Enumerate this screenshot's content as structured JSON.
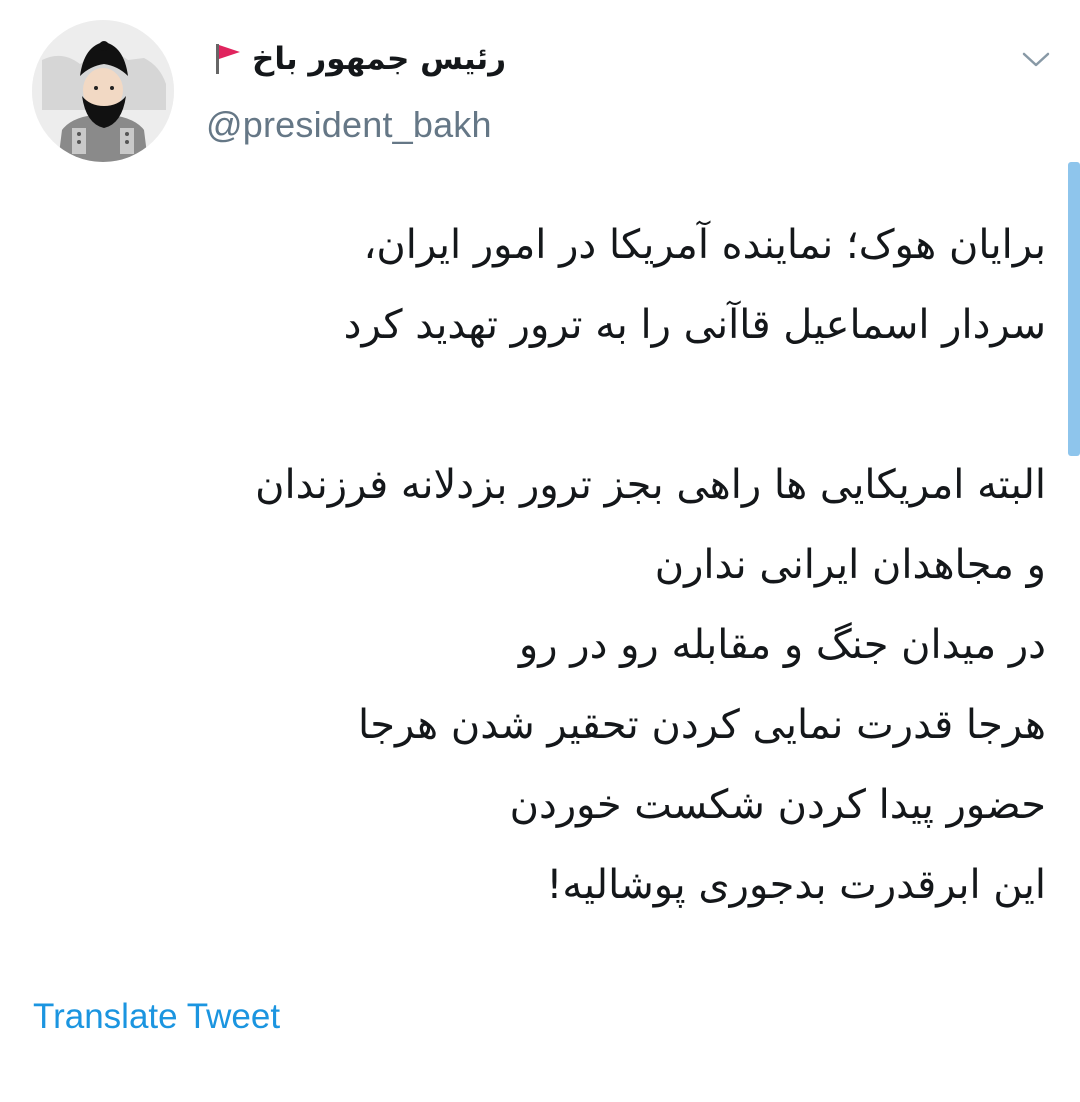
{
  "header": {
    "display_name": "رئیس جمهور باخ",
    "handle": "@president_bakh",
    "avatar_icon": "bearded-man-avatar",
    "flag_icon": "red-flag-icon",
    "menu_icon": "chevron-down-icon"
  },
  "tweet": {
    "lines": [
      "برایان هوک؛ نماینده آمریکا در امور ایران،",
      "سردار اسماعیل قاآنی را به ترور تهدید کرد",
      "",
      "البته امریکایی ها راهی بجز ترور بزدلانه فرزندان",
      "و مجاهدان ایرانی ندارن",
      "در میدان جنگ و مقابله رو در رو",
      "هرجا قدرت نمایی کردن تحقیر شدن هرجا",
      "حضور پیدا کردن شکست خوردن",
      "این ابرقدرت بدجوری پوشالیه!"
    ]
  },
  "actions": {
    "translate_label": "Translate Tweet"
  },
  "colors": {
    "accent": "#1b95e0",
    "secondary_text": "#657786",
    "flag": "#e0245e",
    "scroll_indicator": "#8ec5ec"
  }
}
